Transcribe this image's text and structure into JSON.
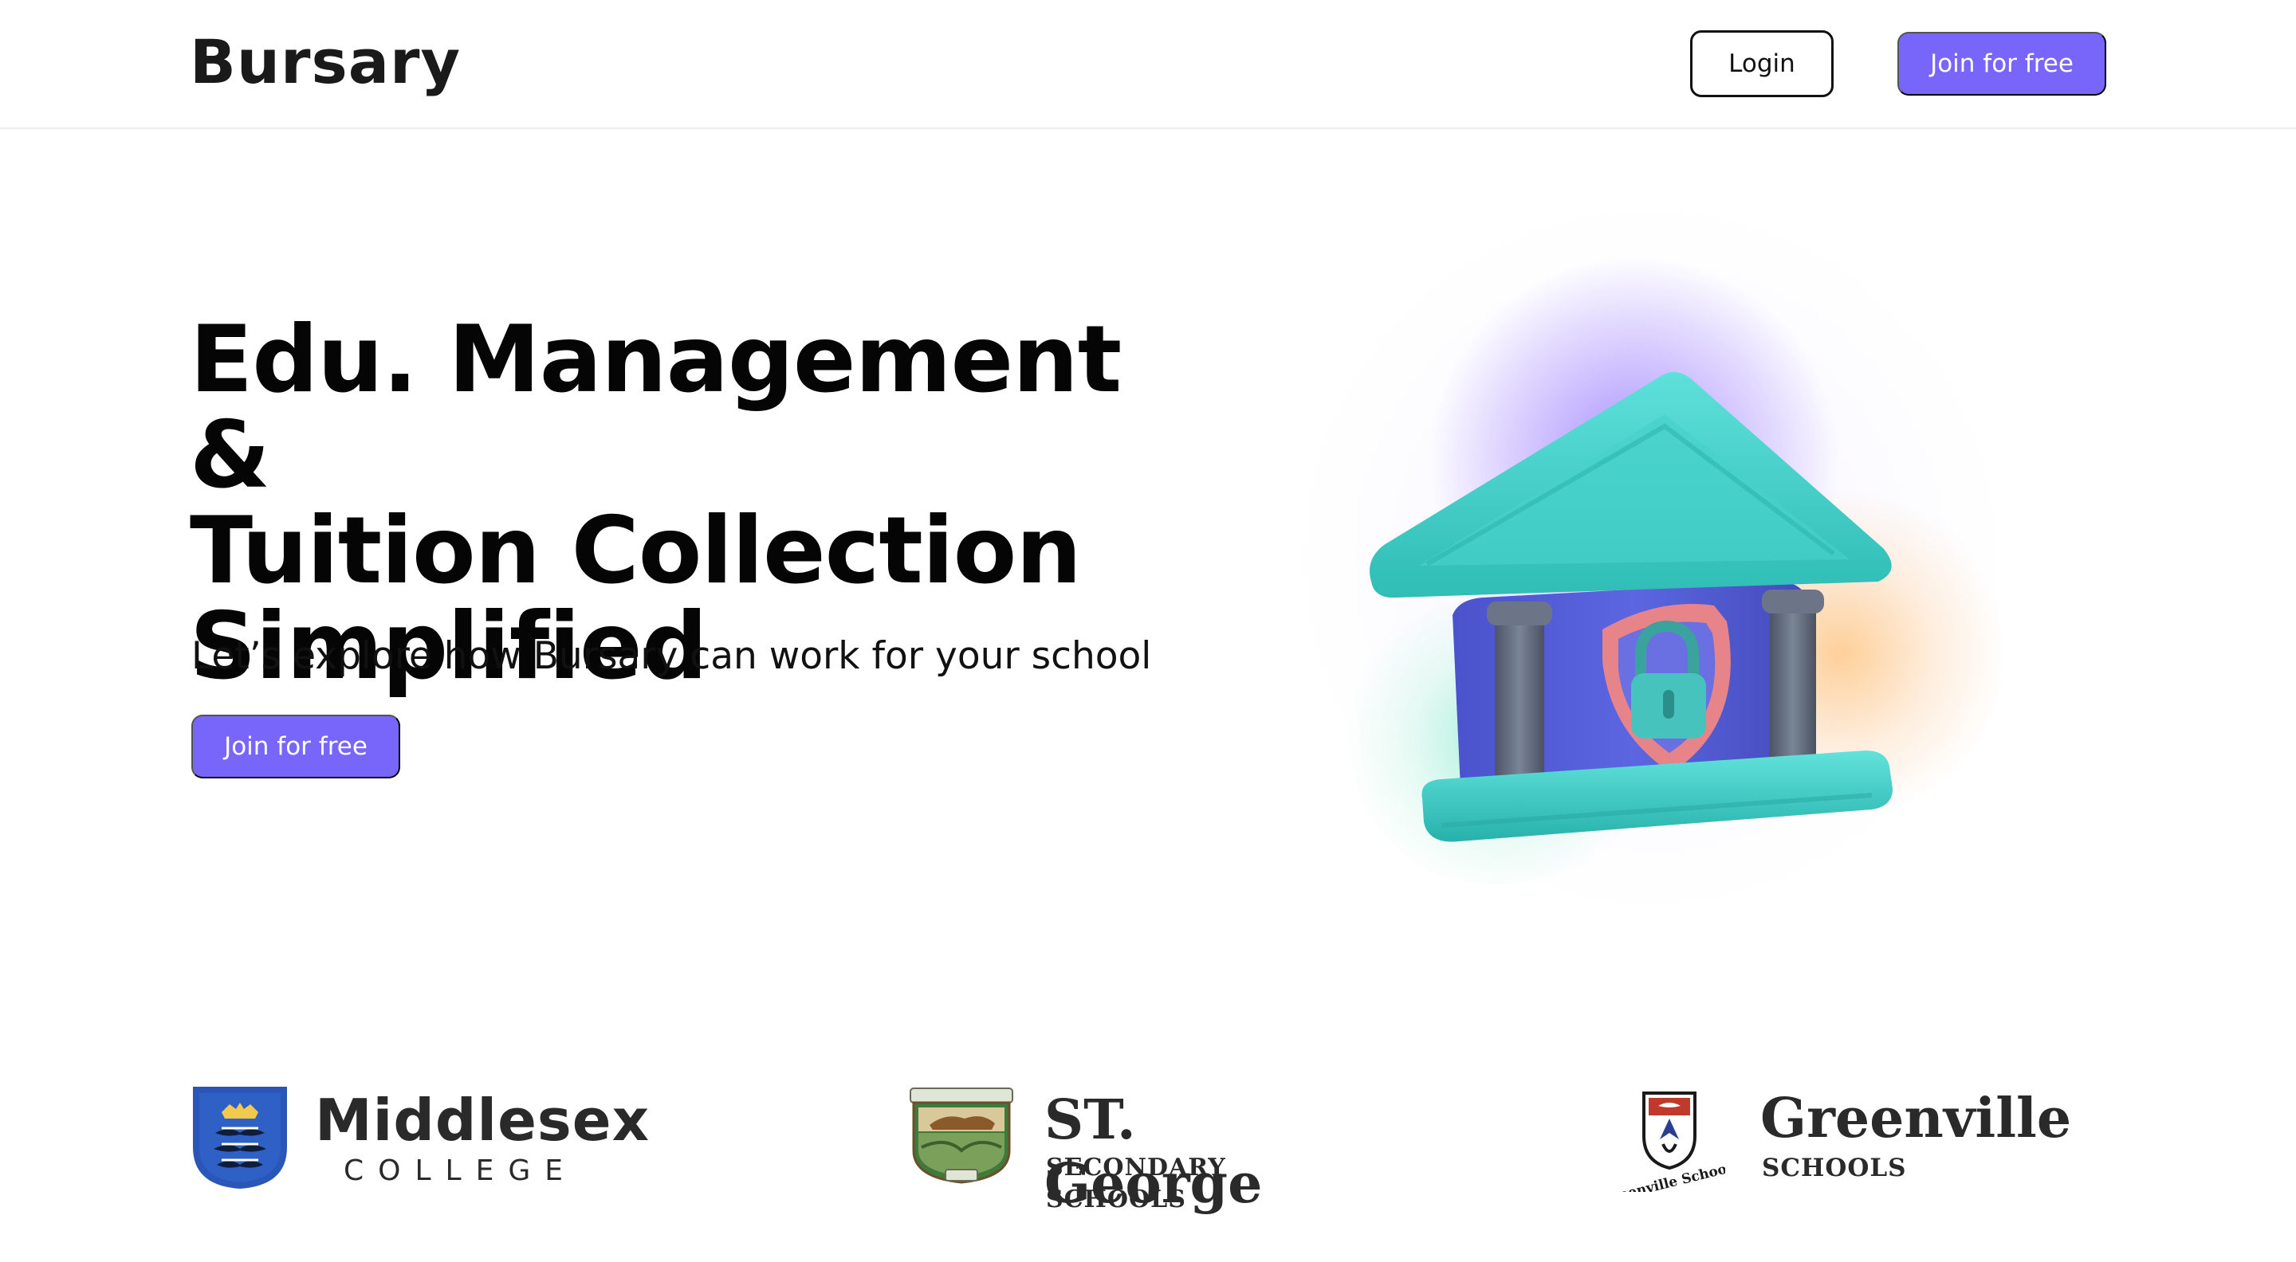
{
  "header": {
    "logo_text": "Bursary",
    "login_label": "Login",
    "join_label": "Join for free"
  },
  "hero": {
    "title_lines": [
      "Edu. Management &",
      "Tuition Collection",
      "Simplified"
    ],
    "subtitle": "Let’s explore how Bursary can work for your school",
    "cta_label": "Join for free",
    "illustration": "bank-with-padlock-shield-icon"
  },
  "partners": [
    {
      "name": "Middlesex",
      "subtitle": "COLLEGE",
      "icon": "swan-crest-shield-icon"
    },
    {
      "name": "ST. George",
      "subtitle": "SECONDARY SCHOOLS",
      "icon": "st-george-crest-icon"
    },
    {
      "name": "Greenville",
      "subtitle": "SCHOOLS",
      "icon": "greenville-crest-icon",
      "crest_text": "Greenville Schools"
    }
  ],
  "colors": {
    "accent": "#7866fb",
    "text": "#050505",
    "roof": "#3ecfc8",
    "building": "#5561d8",
    "shield": "#e6848a"
  }
}
